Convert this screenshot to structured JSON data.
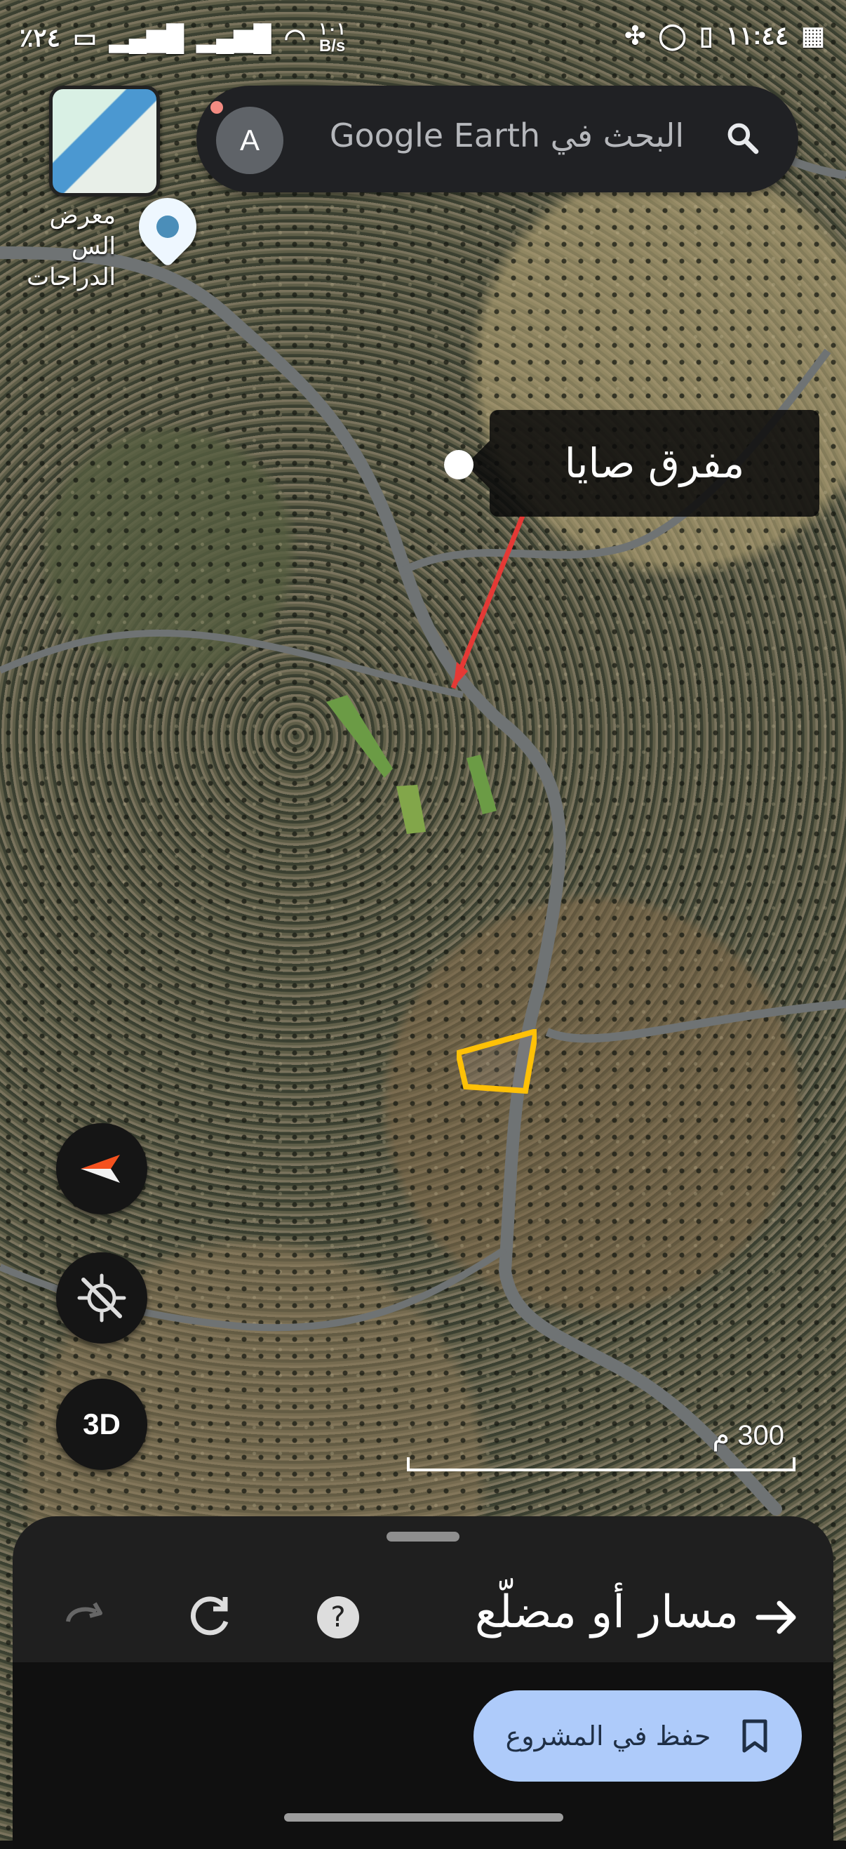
{
  "status_bar": {
    "battery": "٪٢٤",
    "network_speed_value": "١٠١",
    "network_speed_unit": "B/s",
    "time": "١١:٤٤"
  },
  "search": {
    "avatar_initial": "A",
    "placeholder": "البحث في Google Earth"
  },
  "map": {
    "place_label": "معرض الس الدراجات",
    "callout_label": "مفرق صايا",
    "scale_label": "300 م",
    "colors": {
      "road": "#6f7374",
      "red_arrow": "#e53935",
      "parcel": "#ffc107"
    }
  },
  "controls": {
    "compass_icon": "compass-icon",
    "locate_icon": "location-off-icon",
    "three_d_label": "3D"
  },
  "sheet": {
    "route_label": "مسار أو مضلّع",
    "save_label": "حفظ في المشروع"
  }
}
